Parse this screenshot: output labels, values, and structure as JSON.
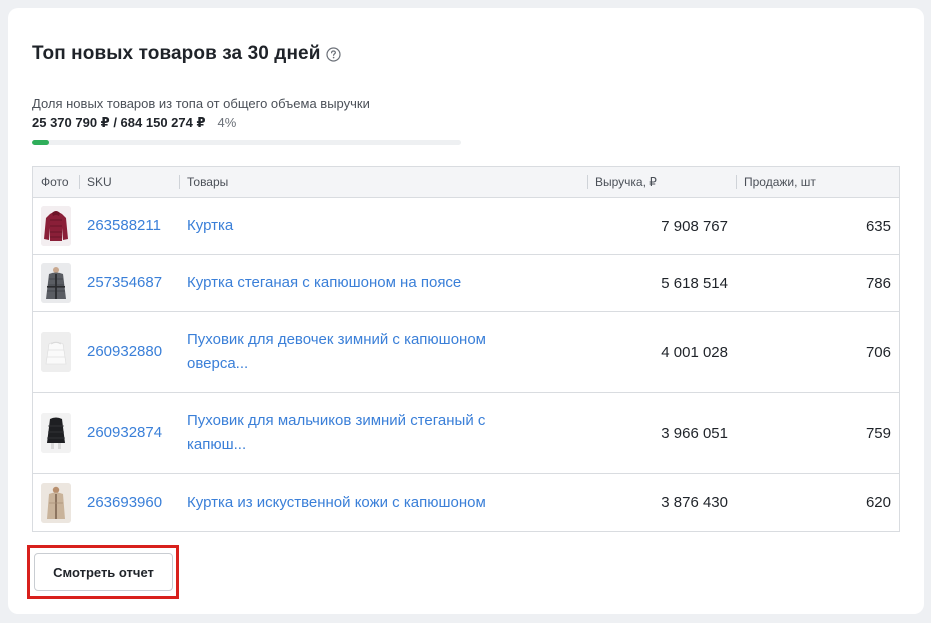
{
  "widget": {
    "title": "Топ новых товаров за 30 дней",
    "share_caption": "Доля новых товаров из топа от общего объема выручки",
    "share_amount": "25 370 790 ₽ / 684 150 274 ₽",
    "share_percent": "4%",
    "share_fraction": 0.04,
    "progress_color": "#2fae5a"
  },
  "table": {
    "columns": [
      "Фото",
      "SKU",
      "Товары",
      "Выручка, ₽",
      "Продажи, шт"
    ],
    "rows": [
      {
        "sku": "263588211",
        "name": "Куртка",
        "revenue": "7 908 767",
        "sales": "635",
        "photo": "burgundy-puffer-jacket"
      },
      {
        "sku": "257354687",
        "name": "Куртка стеганая с капюшоном на поясе",
        "revenue": "5 618 514",
        "sales": "786",
        "photo": "grey-quilted-jacket"
      },
      {
        "sku": "260932880",
        "name": "Пуховик для девочек зимний с капюшоном оверса...",
        "revenue": "4 001 028",
        "sales": "706",
        "photo": "white-down-coat"
      },
      {
        "sku": "260932874",
        "name": "Пуховик для мальчиков зимний стеганый с капюш...",
        "revenue": "3 966 051",
        "sales": "759",
        "photo": "black-down-coat"
      },
      {
        "sku": "263693960",
        "name": "Куртка из искуственной кожи с капюшоном",
        "revenue": "3 876 430",
        "sales": "620",
        "photo": "beige-leather-jacket"
      }
    ]
  },
  "report_button": {
    "label": "Смотреть отчет"
  },
  "colors": {
    "link": "#3a7fd8",
    "highlight": "#d8201c"
  }
}
